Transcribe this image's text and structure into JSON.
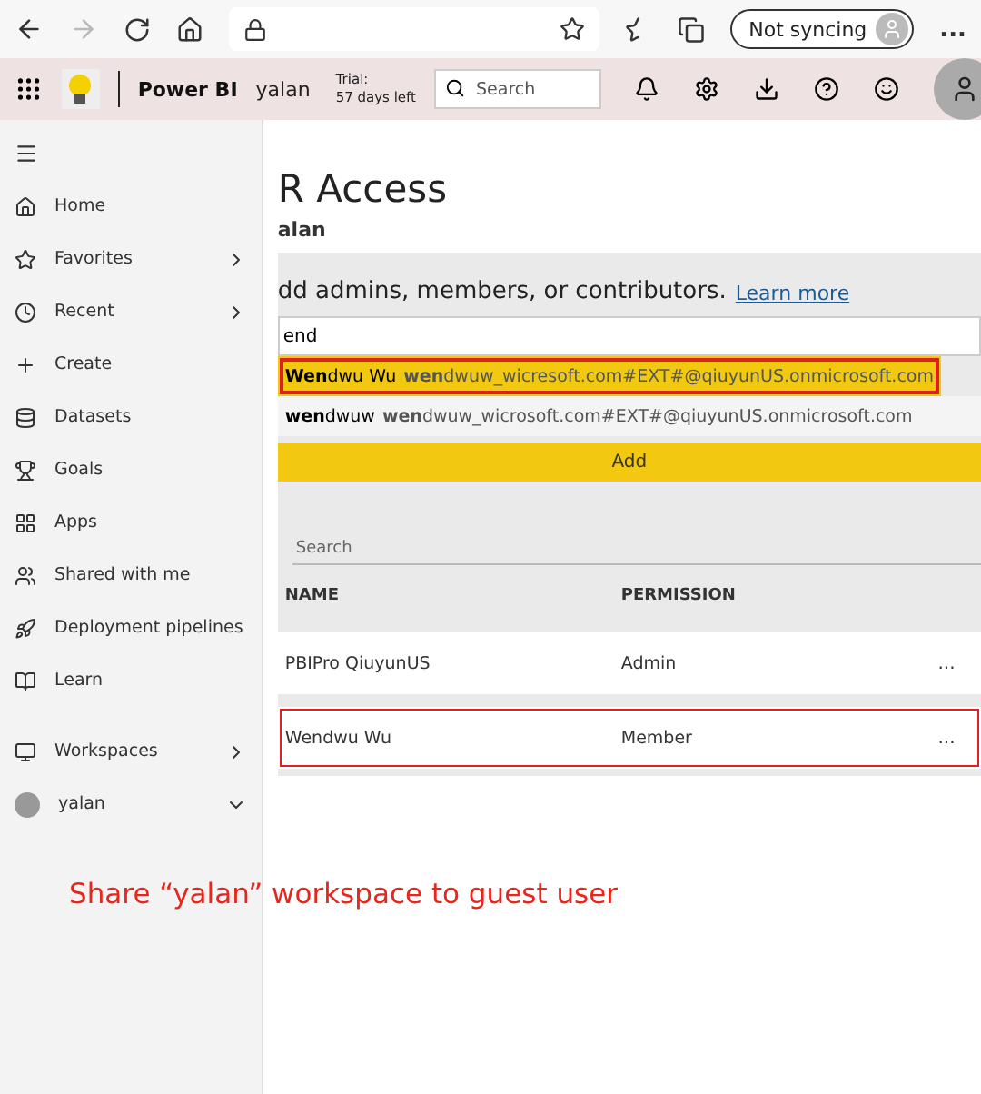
{
  "browser": {
    "forward_disabled": true,
    "sync_label": "Not syncing",
    "more": "..."
  },
  "header": {
    "app_name": "Power BI",
    "workspace": "yalan",
    "trial": [
      "Trial:",
      "57 days left"
    ],
    "search": {
      "placeholder": "Search"
    }
  },
  "sidebar": {
    "items": [
      {
        "label": "Home",
        "kind": "nav",
        "expandable": false
      },
      {
        "label": "Favorites",
        "kind": "nav",
        "expandable": true,
        "expanded": false
      },
      {
        "label": "Recent",
        "kind": "nav",
        "expandable": true,
        "expanded": false
      },
      {
        "label": "Create",
        "kind": "nav",
        "expandable": false
      },
      {
        "label": "Datasets",
        "kind": "nav",
        "expandable": false
      },
      {
        "label": "Goals",
        "kind": "nav",
        "expandable": false
      },
      {
        "label": "Apps",
        "kind": "nav",
        "expandable": false
      },
      {
        "label": "Shared with me",
        "kind": "nav",
        "expandable": false
      },
      {
        "label": "Deployment pipelines",
        "kind": "nav",
        "expandable": false
      },
      {
        "label": "Learn",
        "kind": "nav",
        "expandable": false
      },
      {
        "label": "Workspaces",
        "kind": "workspace",
        "expandable": true,
        "expanded": false
      },
      {
        "label": "yalan",
        "kind": "workspace",
        "expandable": true,
        "expanded": true
      }
    ]
  },
  "access": {
    "title": "R Access",
    "subtitle": "alan",
    "instruction": "dd admins, members, or contributors.",
    "link": "Learn more",
    "input": {
      "value": "end"
    },
    "suggestions": [
      {
        "name": "**Wen**dwu Wu",
        "email": "**wen**dwuw_wicresoft.com#EXT#@qiuyunUS.onmicrosoft.com",
        "selected": true,
        "outlined": true
      },
      {
        "name": "**wen**dwuw",
        "email": "**wen**dwuw_wicrosoft.com#EXT#@qiuyunUS.onmicrosoft.com",
        "selected": false,
        "outlined": false
      }
    ],
    "add_button": "Add",
    "search": {
      "placeholder": "Search"
    },
    "columns": [
      "NAME",
      "PERMISSION"
    ],
    "rows": [
      {
        "name": "PBIPro QiuyunUS",
        "permission": "Admin",
        "menu": "...",
        "outlined": false
      },
      {
        "name": "Wendwu Wu",
        "permission": "Member",
        "menu": "...",
        "outlined": true
      }
    ]
  },
  "annotation": "Share “yalan” workspace to guest user"
}
